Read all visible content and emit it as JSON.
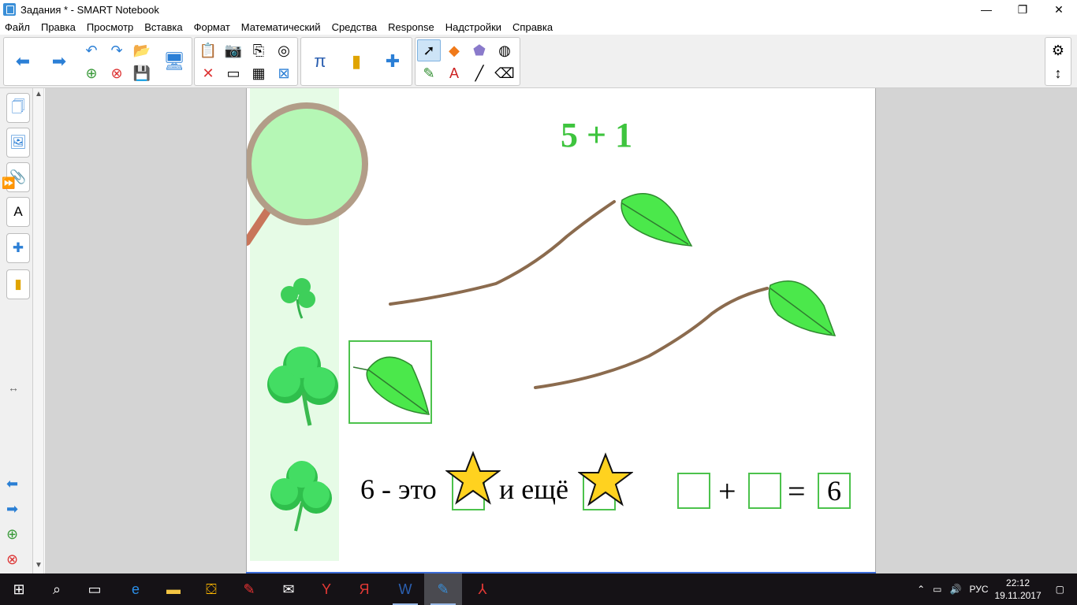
{
  "window": {
    "title": "Задания * - SMART Notebook",
    "min": "—",
    "max": "❐",
    "close": "✕"
  },
  "menu": [
    "Файл",
    "Правка",
    "Просмотр",
    "Вставка",
    "Формат",
    "Математический",
    "Средства",
    "Response",
    "Надстройки",
    "Справка"
  ],
  "page": {
    "equation_title": "5 + 1",
    "sentence_part1": "6 - это",
    "sentence_part2": "и ещё",
    "plus": "+",
    "equals": "=",
    "answer": "6"
  },
  "colors": {
    "accent_green": "#3ec43e",
    "box_border": "#4cc24c",
    "strip": "#e6fbe6",
    "taskbar": "#151216"
  },
  "tray": {
    "lang": "РУС",
    "time": "22:12",
    "date": "19.11.2017"
  }
}
